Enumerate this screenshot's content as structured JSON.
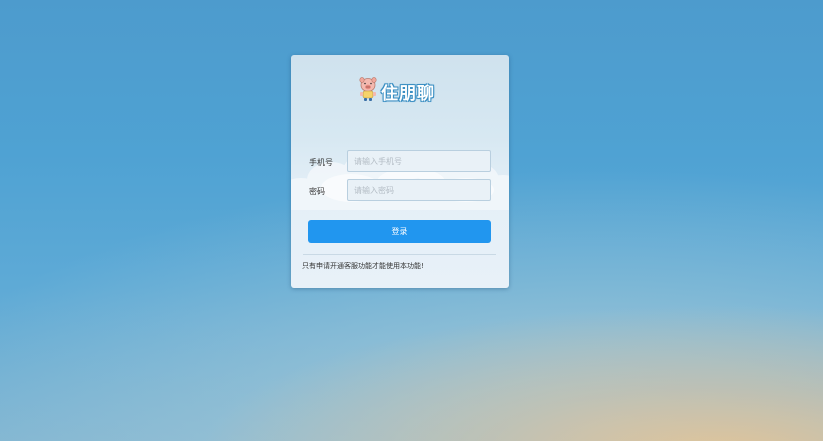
{
  "brand": {
    "logo_text": "住朋聊"
  },
  "form": {
    "phone_label": "手机号",
    "phone_placeholder": "请输入手机号",
    "phone_value": "",
    "password_label": "密码",
    "password_placeholder": "请输入密码",
    "password_value": "",
    "submit_label": "登录"
  },
  "notice": "只有申请开通客服功能才能使用本功能!",
  "icons": {
    "logo": "pig-mascot-icon"
  },
  "colors": {
    "accent": "#2196ef",
    "card_background": "#e4eff7",
    "page_background": "#4fa2d3"
  }
}
